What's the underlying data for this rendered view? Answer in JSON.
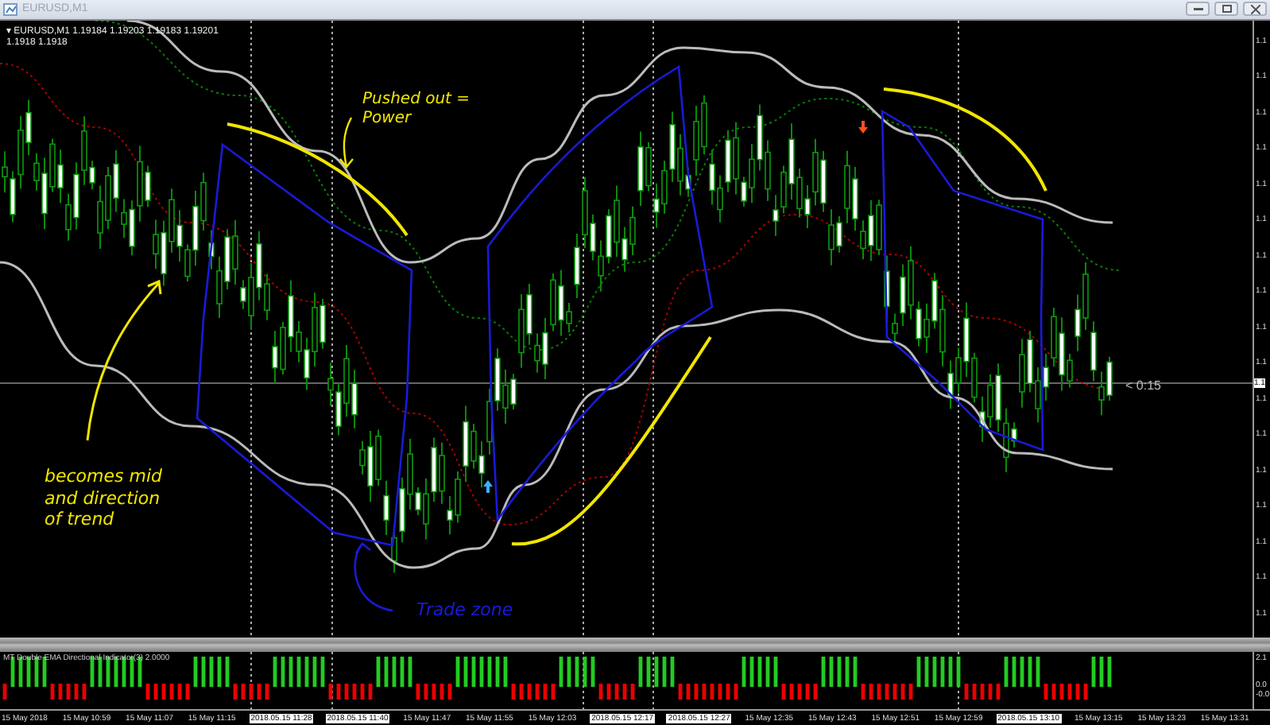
{
  "window": {
    "title": "EURUSD,M1"
  },
  "chart": {
    "menu_glyph": "▾",
    "symbol": "EURUSD,M1",
    "ohlc": [
      "1.19184",
      "1.19203",
      "1.19183",
      "1.19201"
    ],
    "bid_ask": [
      "1.1918",
      "1.1918"
    ],
    "countdown": "< 0:15",
    "price_labels": [
      "1.1",
      "1.1",
      "1.1",
      "1.1",
      "1.1",
      "1.1",
      "1.1",
      "1.1",
      "1.1",
      "1.1",
      "1.1",
      "1.1",
      "1.1",
      "1.1",
      "1.1",
      "1.1",
      "1.1"
    ],
    "current_price": "1.1",
    "annotations": [
      {
        "kind": "note",
        "color": "#f0e600",
        "text": "Pushed out = Power"
      },
      {
        "kind": "note",
        "color": "#f0e600",
        "text": "becomes mid and direction of trend"
      },
      {
        "kind": "note",
        "color": "#1a1ad8",
        "text": "Trade zone"
      }
    ]
  },
  "indicator": {
    "label": "MT Double EMA Directional Indicator(3) 2.0000",
    "scale": [
      "2.1",
      "0.0",
      "-0.0"
    ]
  },
  "time_axis": [
    {
      "label": "15 May 2018",
      "highlighted": false
    },
    {
      "label": "15 May 10:59",
      "highlighted": false
    },
    {
      "label": "15 May 11:07",
      "highlighted": false
    },
    {
      "label": "15 May 11:15",
      "highlighted": false
    },
    {
      "label": "2018.05.15 11:28",
      "highlighted": true
    },
    {
      "label": "2018.05.15 11:40",
      "highlighted": true
    },
    {
      "label": "15 May 11:47",
      "highlighted": false
    },
    {
      "label": "15 May 11:55",
      "highlighted": false
    },
    {
      "label": "15 May 12:03",
      "highlighted": false
    },
    {
      "label": "2018.05.15 12:17",
      "highlighted": true
    },
    {
      "label": "2018.05.15 12:27",
      "highlighted": true
    },
    {
      "label": "15 May 12:35",
      "highlighted": false
    },
    {
      "label": "15 May 12:43",
      "highlighted": false
    },
    {
      "label": "15 May 12:51",
      "highlighted": false
    },
    {
      "label": "15 May 12:59",
      "highlighted": false
    },
    {
      "label": "2018.05.15 13:10",
      "highlighted": true
    },
    {
      "label": "15 May 13:15",
      "highlighted": false
    },
    {
      "label": "15 May 13:23",
      "highlighted": false
    },
    {
      "label": "15 May 13:31",
      "highlighted": false
    }
  ]
}
